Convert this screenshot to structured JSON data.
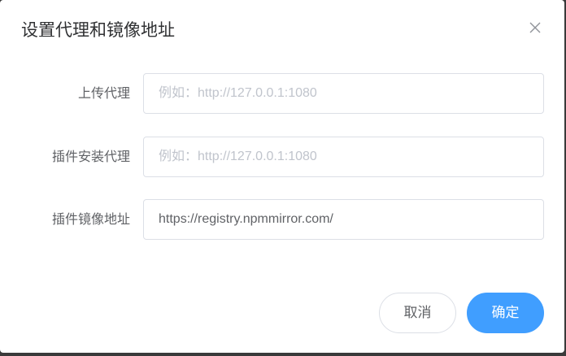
{
  "dialog": {
    "title": "设置代理和镜像地址"
  },
  "form": {
    "upload_proxy": {
      "label": "上传代理",
      "value": "",
      "placeholder": "例如：http://127.0.0.1:1080"
    },
    "plugin_install_proxy": {
      "label": "插件安装代理",
      "value": "",
      "placeholder": "例如：http://127.0.0.1:1080"
    },
    "plugin_mirror": {
      "label": "插件镜像地址",
      "value": "https://registry.npmmirror.com/",
      "placeholder": ""
    }
  },
  "footer": {
    "cancel_label": "取消",
    "confirm_label": "确定"
  },
  "icons": {
    "close": "close-icon"
  },
  "colors": {
    "primary": "#409eff",
    "border": "#dcdfe6",
    "label": "#606266",
    "title": "#303133",
    "placeholder": "#c0c4cc"
  }
}
